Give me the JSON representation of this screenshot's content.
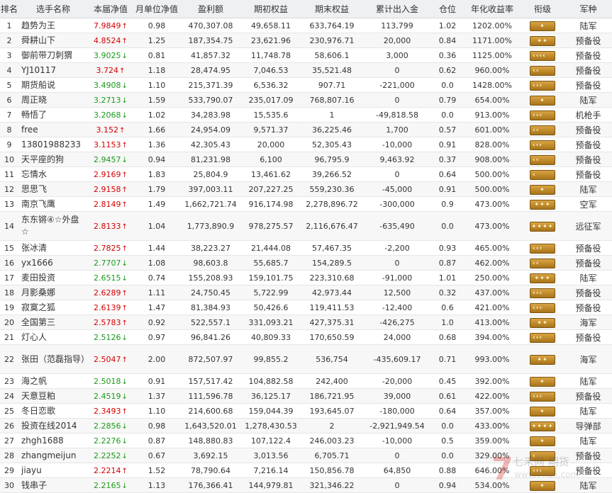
{
  "headers": [
    "排名",
    "选手名称",
    "本届净值",
    "月单位净值",
    "盈利额",
    "期初权益",
    "期末权益",
    "累计出入金",
    "仓位",
    "年化收益率",
    "衔级",
    "军种"
  ],
  "rows": [
    {
      "rank": "1",
      "name": "趋势为王",
      "nav": "7.9849",
      "dir": "up",
      "monthly": "0.98",
      "profit": "470,307.08",
      "start": "49,658.11",
      "end": "633,764.19",
      "flow": "113,799",
      "pos": "1.02",
      "annual": "1202.00%",
      "rank_badge": "stars-1",
      "branch": "陆军"
    },
    {
      "rank": "2",
      "name": "舜耕山下",
      "nav": "4.8524",
      "dir": "up",
      "monthly": "1.25",
      "profit": "187,354.75",
      "start": "23,621.96",
      "end": "230,976.71",
      "flow": "20,000",
      "pos": "0.84",
      "annual": "1171.00%",
      "rank_badge": "stars-2",
      "branch": "预备役"
    },
    {
      "rank": "3",
      "name": "御前带刀刺猬",
      "nav": "3.9025",
      "dir": "down",
      "monthly": "0.81",
      "profit": "41,857.32",
      "start": "11,748.78",
      "end": "58,606.1",
      "flow": "3,000",
      "pos": "0.36",
      "annual": "1125.00%",
      "rank_badge": "chev-4",
      "branch": "预备役"
    },
    {
      "rank": "4",
      "name": "YJ10117",
      "nav": "3.724",
      "dir": "up",
      "monthly": "1.18",
      "profit": "28,474.95",
      "start": "7,046.53",
      "end": "35,521.48",
      "flow": "0",
      "pos": "0.62",
      "annual": "960.00%",
      "rank_badge": "chev-2",
      "branch": "预备役"
    },
    {
      "rank": "5",
      "name": "期货船说",
      "nav": "3.4908",
      "dir": "down",
      "monthly": "1.10",
      "profit": "215,371.39",
      "start": "6,536.32",
      "end": "907.71",
      "flow": "-221,000",
      "pos": "0.0",
      "annual": "1428.00%",
      "rank_badge": "chev-3",
      "branch": "预备役"
    },
    {
      "rank": "6",
      "name": "周正晓",
      "nav": "3.2713",
      "dir": "down",
      "monthly": "1.59",
      "profit": "533,790.07",
      "start": "235,017.09",
      "end": "768,807.16",
      "flow": "0",
      "pos": "0.79",
      "annual": "654.00%",
      "rank_badge": "stars-1",
      "branch": "陆军"
    },
    {
      "rank": "7",
      "name": "畅悟了",
      "nav": "3.2068",
      "dir": "down",
      "monthly": "1.02",
      "profit": "34,283.98",
      "start": "15,535.6",
      "end": "1",
      "flow": "-49,818.58",
      "pos": "0.0",
      "annual": "913.00%",
      "rank_badge": "chev-3",
      "branch": "机枪手"
    },
    {
      "rank": "8",
      "name": "free",
      "nav": "3.152",
      "dir": "up",
      "monthly": "1.66",
      "profit": "24,954.09",
      "start": "9,571.37",
      "end": "36,225.46",
      "flow": "1,700",
      "pos": "0.57",
      "annual": "601.00%",
      "rank_badge": "chev-2",
      "branch": "预备役"
    },
    {
      "rank": "9",
      "name": "13801988233",
      "nav": "3.1153",
      "dir": "up",
      "monthly": "1.36",
      "profit": "42,305.43",
      "start": "20,000",
      "end": "52,305.43",
      "flow": "-10,000",
      "pos": "0.91",
      "annual": "828.00%",
      "rank_badge": "chev-3",
      "branch": "预备役"
    },
    {
      "rank": "10",
      "name": "天平座的狗",
      "nav": "2.9457",
      "dir": "down",
      "monthly": "0.94",
      "profit": "81,231.98",
      "start": "6,100",
      "end": "96,795.9",
      "flow": "9,463.92",
      "pos": "0.37",
      "annual": "908.00%",
      "rank_badge": "chev-2",
      "branch": "预备役"
    },
    {
      "rank": "11",
      "name": "忘情水",
      "nav": "2.9169",
      "dir": "up",
      "monthly": "1.83",
      "profit": "25,804.9",
      "start": "13,461.62",
      "end": "39,266.52",
      "flow": "0",
      "pos": "0.64",
      "annual": "500.00%",
      "rank_badge": "chev-1",
      "branch": "预备役"
    },
    {
      "rank": "12",
      "name": "思思飞",
      "nav": "2.9158",
      "dir": "up",
      "monthly": "1.79",
      "profit": "397,003.11",
      "start": "207,227.25",
      "end": "559,230.36",
      "flow": "-45,000",
      "pos": "0.91",
      "annual": "500.00%",
      "rank_badge": "stars-1",
      "branch": "陆军"
    },
    {
      "rank": "13",
      "name": "南京飞鹰",
      "nav": "2.8149",
      "dir": "up",
      "monthly": "1.49",
      "profit": "1,662,721.74",
      "start": "916,174.98",
      "end": "2,278,896.72",
      "flow": "-300,000",
      "pos": "0.9",
      "annual": "473.00%",
      "rank_badge": "stars-3",
      "branch": "空军"
    },
    {
      "rank": "14",
      "name": "东东锵④☆外盘☆",
      "nav": "2.8133",
      "dir": "up",
      "monthly": "1.04",
      "profit": "1,773,890.9",
      "start": "978,275.57",
      "end": "2,116,676.47",
      "flow": "-635,490",
      "pos": "0.0",
      "annual": "473.00%",
      "rank_badge": "stars-4",
      "branch": "远征军",
      "tall": true
    },
    {
      "rank": "15",
      "name": "张冰清",
      "nav": "2.7825",
      "dir": "up",
      "monthly": "1.44",
      "profit": "38,223.27",
      "start": "21,444.08",
      "end": "57,467.35",
      "flow": "-2,200",
      "pos": "0.93",
      "annual": "465.00%",
      "rank_badge": "chev-3",
      "branch": "预备役"
    },
    {
      "rank": "16",
      "name": "yx1666",
      "nav": "2.7707",
      "dir": "down",
      "monthly": "1.08",
      "profit": "98,603.8",
      "start": "55,685.7",
      "end": "154,289.5",
      "flow": "0",
      "pos": "0.87",
      "annual": "462.00%",
      "rank_badge": "chev-2",
      "branch": "预备役"
    },
    {
      "rank": "17",
      "name": "麦田投资",
      "nav": "2.6515",
      "dir": "down",
      "monthly": "0.74",
      "profit": "155,208.93",
      "start": "159,101.75",
      "end": "223,310.68",
      "flow": "-91,000",
      "pos": "1.01",
      "annual": "250.00%",
      "rank_badge": "stars-3",
      "branch": "陆军"
    },
    {
      "rank": "18",
      "name": "月影桑娜",
      "nav": "2.6289",
      "dir": "up",
      "monthly": "1.11",
      "profit": "24,750.45",
      "start": "5,722.99",
      "end": "42,973.44",
      "flow": "12,500",
      "pos": "0.32",
      "annual": "437.00%",
      "rank_badge": "chev-3",
      "branch": "预备役"
    },
    {
      "rank": "19",
      "name": "寂寞之狐",
      "nav": "2.6139",
      "dir": "up",
      "monthly": "1.47",
      "profit": "81,384.93",
      "start": "50,426.6",
      "end": "119,411.53",
      "flow": "-12,400",
      "pos": "0.6",
      "annual": "421.00%",
      "rank_badge": "chev-3",
      "branch": "预备役"
    },
    {
      "rank": "20",
      "name": "全国第三",
      "nav": "2.5783",
      "dir": "up",
      "monthly": "0.92",
      "profit": "522,557.1",
      "start": "331,093.21",
      "end": "427,375.31",
      "flow": "-426,275",
      "pos": "1.0",
      "annual": "413.00%",
      "rank_badge": "stars-2",
      "branch": "海军"
    },
    {
      "rank": "21",
      "name": "灯心人",
      "nav": "2.5126",
      "dir": "down",
      "monthly": "0.97",
      "profit": "96,841.26",
      "start": "40,809.33",
      "end": "170,650.59",
      "flow": "24,000",
      "pos": "0.68",
      "annual": "394.00%",
      "rank_badge": "chev-3",
      "branch": "预备役"
    },
    {
      "rank": "22",
      "name": "张田（范磊指导）",
      "nav": "2.5047",
      "dir": "up",
      "monthly": "2.00",
      "profit": "872,507.97",
      "start": "99,855.2",
      "end": "536,754",
      "flow": "-435,609.17",
      "pos": "0.71",
      "annual": "993.00%",
      "rank_badge": "stars-2",
      "branch": "海军",
      "tall": true
    },
    {
      "rank": "23",
      "name": "海之帆",
      "nav": "2.5018",
      "dir": "down",
      "monthly": "0.91",
      "profit": "157,517.42",
      "start": "104,882.58",
      "end": "242,400",
      "flow": "-20,000",
      "pos": "0.45",
      "annual": "392.00%",
      "rank_badge": "stars-1",
      "branch": "陆军"
    },
    {
      "rank": "24",
      "name": "天意豆粕",
      "nav": "2.4519",
      "dir": "down",
      "monthly": "1.37",
      "profit": "111,596.78",
      "start": "36,125.17",
      "end": "186,721.95",
      "flow": "39,000",
      "pos": "0.61",
      "annual": "422.00%",
      "rank_badge": "chev-3",
      "branch": "预备役"
    },
    {
      "rank": "25",
      "name": "冬日恋歌",
      "nav": "2.3493",
      "dir": "up",
      "monthly": "1.10",
      "profit": "214,600.68",
      "start": "159,044.39",
      "end": "193,645.07",
      "flow": "-180,000",
      "pos": "0.64",
      "annual": "357.00%",
      "rank_badge": "stars-1",
      "branch": "陆军"
    },
    {
      "rank": "26",
      "name": "投资在线2014",
      "nav": "2.2856",
      "dir": "down",
      "monthly": "0.98",
      "profit": "1,643,520.01",
      "start": "1,278,430.53",
      "end": "2",
      "flow": "-2,921,949.54",
      "pos": "0.0",
      "annual": "433.00%",
      "rank_badge": "stars-4",
      "branch": "导弹部"
    },
    {
      "rank": "27",
      "name": "zhgh1688",
      "nav": "2.2276",
      "dir": "down",
      "monthly": "0.87",
      "profit": "148,880.83",
      "start": "107,122.4",
      "end": "246,003.23",
      "flow": "-10,000",
      "pos": "0.5",
      "annual": "359.00%",
      "rank_badge": "stars-1",
      "branch": "陆军"
    },
    {
      "rank": "28",
      "name": "zhangmeijun",
      "nav": "2.2252",
      "dir": "down",
      "monthly": "0.67",
      "profit": "3,692.15",
      "start": "3,013.56",
      "end": "6,705.71",
      "flow": "0",
      "pos": "0.0",
      "annual": "329.00%",
      "rank_badge": "chev-1",
      "branch": "预备役"
    },
    {
      "rank": "29",
      "name": "jiayu",
      "nav": "2.2214",
      "dir": "up",
      "monthly": "1.52",
      "profit": "78,790.64",
      "start": "7,216.14",
      "end": "150,856.78",
      "flow": "64,850",
      "pos": "0.88",
      "annual": "646.00%",
      "rank_badge": "chev-3",
      "branch": "预备役"
    },
    {
      "rank": "30",
      "name": "钱串子",
      "nav": "2.2165",
      "dir": "down",
      "monthly": "1.13",
      "profit": "176,366.41",
      "start": "144,979.81",
      "end": "321,346.22",
      "flow": "0",
      "pos": "0.94",
      "annual": "534.00%",
      "rank_badge": "stars-1",
      "branch": "陆军"
    }
  ],
  "watermark": {
    "line1": "七禾网 期货",
    "line2": "www.7hcn.com"
  },
  "colors": {
    "up": "#d40000",
    "down": "#1a9a1a",
    "header_bg": "#eef0f2",
    "badge": "#c08a2a"
  }
}
